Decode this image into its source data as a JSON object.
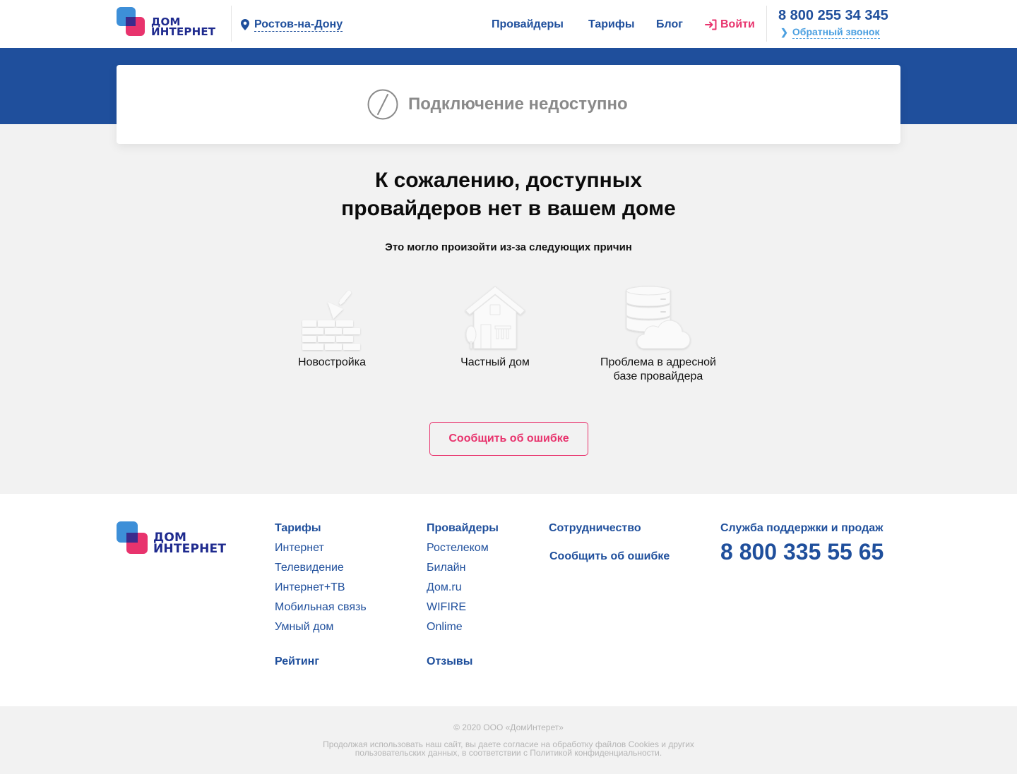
{
  "header": {
    "logo_line1": "ДОМ",
    "logo_line2": "ИНТЕРНЕТ",
    "city": "Ростов-на-Дону",
    "nav": [
      "Провайдеры",
      "Тарифы",
      "Блог"
    ],
    "login": "Войти",
    "phone": "8 800 255 34 345",
    "callback": "Обратный звонок"
  },
  "status": {
    "message": "Подключение недоступно"
  },
  "main": {
    "title_line1": "К сожалению, доступных",
    "title_line2": "провайдеров нет в вашем доме",
    "subtitle": "Это могло произойти из-за следующих причин",
    "reasons": [
      {
        "icon": "brick-trowel-icon",
        "label": "Новостройка"
      },
      {
        "icon": "private-house-icon",
        "label": "Частный дом"
      },
      {
        "icon": "database-cloud-icon",
        "label_line1": "Проблема в адресной",
        "label_line2": "базе провайдера"
      }
    ],
    "report_button": "Сообщить об ошибке"
  },
  "footer": {
    "logo_line1": "ДОМ",
    "logo_line2": "ИНТЕРНЕТ",
    "tariffs": {
      "heading": "Тарифы",
      "items": [
        "Интернет",
        "Телевидение",
        "Интернет+ТВ",
        "Мобильная связь",
        "Умный дом"
      ]
    },
    "rating": "Рейтинг",
    "providers": {
      "heading": "Провайдеры",
      "items": [
        "Ростелеком",
        "Билайн",
        "Дом.ru",
        "WIFIRE",
        "Onlime"
      ]
    },
    "reviews": "Отзывы",
    "cooperation": "Сотрудничество",
    "report_error": "Сообщить об ошибке",
    "support_label": "Служба поддержки и продаж",
    "support_phone": "8 800 335 55 65",
    "copyright": "© 2020 ООО «ДомИнтерет»",
    "cookie_line1": "Продолжая использовать наш сайт, вы даете согласие на обработку файлов Cookies и других",
    "cookie_line2": "пользовательских данных, в соответствии с Политикой конфиденциальности."
  },
  "colors": {
    "brand_blue": "#1f4f9c",
    "accent_pink": "#e8336d",
    "light_blue": "#4a9fe0"
  }
}
